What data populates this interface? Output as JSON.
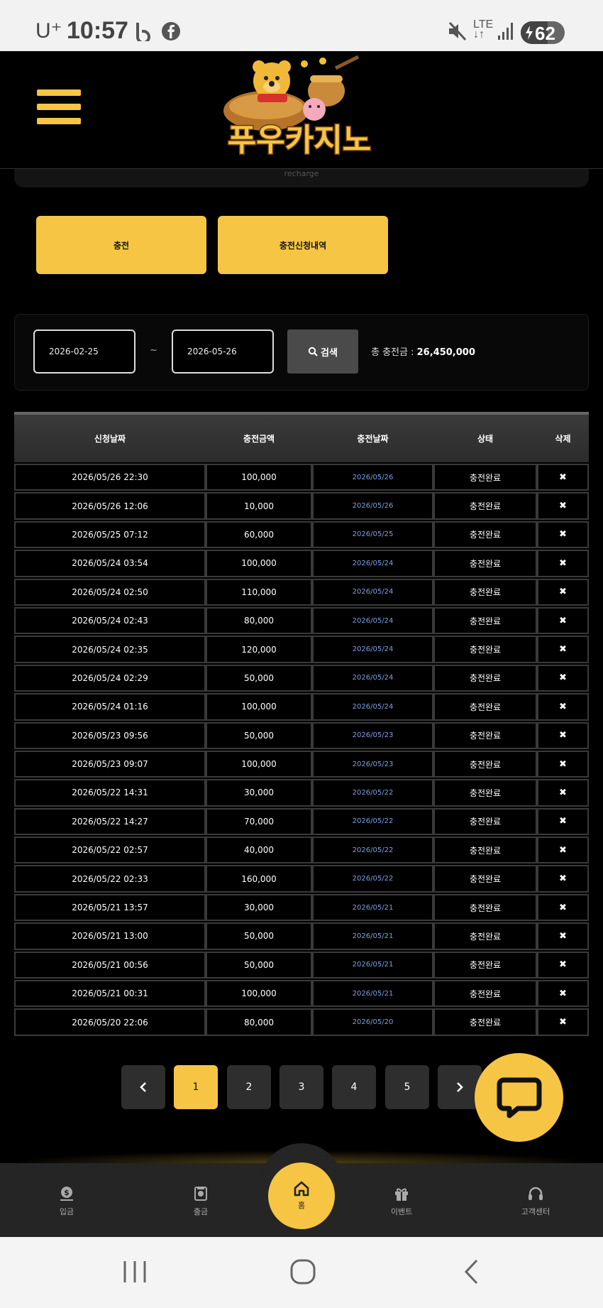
{
  "status_bar": {
    "carrier": "U⁺",
    "time": "10:57",
    "network": "LTE",
    "battery": "62"
  },
  "header": {
    "logo_text": "푸우카지노",
    "recharge_label": "recharge"
  },
  "tabs": [
    {
      "label": "충전"
    },
    {
      "label": "충전신청내역"
    }
  ],
  "search": {
    "start_date": "2026-02-25",
    "separator": "~",
    "end_date": "2026-05-26",
    "button_label": "검색",
    "total_label": "총 충전금 :",
    "total_value": "26,450,000"
  },
  "table": {
    "headers": [
      "신청날짜",
      "충전금액",
      "충전날짜",
      "상태",
      "삭제"
    ],
    "rows": [
      {
        "requested": "2026/05/26 22:30",
        "amount": "100,000",
        "charged": "2026/05/26",
        "status": "충전완료"
      },
      {
        "requested": "2026/05/26 12:06",
        "amount": "10,000",
        "charged": "2026/05/26",
        "status": "충전완료"
      },
      {
        "requested": "2026/05/25 07:12",
        "amount": "60,000",
        "charged": "2026/05/25",
        "status": "충전완료"
      },
      {
        "requested": "2026/05/24 03:54",
        "amount": "100,000",
        "charged": "2026/05/24",
        "status": "충전완료"
      },
      {
        "requested": "2026/05/24 02:50",
        "amount": "110,000",
        "charged": "2026/05/24",
        "status": "충전완료"
      },
      {
        "requested": "2026/05/24 02:43",
        "amount": "80,000",
        "charged": "2026/05/24",
        "status": "충전완료"
      },
      {
        "requested": "2026/05/24 02:35",
        "amount": "120,000",
        "charged": "2026/05/24",
        "status": "충전완료"
      },
      {
        "requested": "2026/05/24 02:29",
        "amount": "50,000",
        "charged": "2026/05/24",
        "status": "충전완료"
      },
      {
        "requested": "2026/05/24 01:16",
        "amount": "100,000",
        "charged": "2026/05/24",
        "status": "충전완료"
      },
      {
        "requested": "2026/05/23 09:56",
        "amount": "50,000",
        "charged": "2026/05/23",
        "status": "충전완료"
      },
      {
        "requested": "2026/05/23 09:07",
        "amount": "100,000",
        "charged": "2026/05/23",
        "status": "충전완료"
      },
      {
        "requested": "2026/05/22 14:31",
        "amount": "30,000",
        "charged": "2026/05/22",
        "status": "충전완료"
      },
      {
        "requested": "2026/05/22 14:27",
        "amount": "70,000",
        "charged": "2026/05/22",
        "status": "충전완료"
      },
      {
        "requested": "2026/05/22 02:57",
        "amount": "40,000",
        "charged": "2026/05/22",
        "status": "충전완료"
      },
      {
        "requested": "2026/05/22 02:33",
        "amount": "160,000",
        "charged": "2026/05/22",
        "status": "충전완료"
      },
      {
        "requested": "2026/05/21 13:57",
        "amount": "30,000",
        "charged": "2026/05/21",
        "status": "충전완료"
      },
      {
        "requested": "2026/05/21 13:00",
        "amount": "50,000",
        "charged": "2026/05/21",
        "status": "충전완료"
      },
      {
        "requested": "2026/05/21 00:56",
        "amount": "50,000",
        "charged": "2026/05/21",
        "status": "충전완료"
      },
      {
        "requested": "2026/05/21 00:31",
        "amount": "100,000",
        "charged": "2026/05/21",
        "status": "충전완료"
      },
      {
        "requested": "2026/05/20 22:06",
        "amount": "80,000",
        "charged": "2026/05/20",
        "status": "충전완료"
      }
    ],
    "delete_symbol": "✖"
  },
  "pagination": {
    "prev_icon": "chevron-left-icon",
    "next_icon": "chevron-right-icon",
    "pages": [
      "1",
      "2",
      "3",
      "4",
      "5"
    ],
    "active": "1"
  },
  "bottom_nav": {
    "items": [
      {
        "label": "입금",
        "icon": "deposit-icon"
      },
      {
        "label": "출금",
        "icon": "withdraw-icon"
      },
      {
        "label": "홈",
        "icon": "home-icon"
      },
      {
        "label": "이벤트",
        "icon": "gift-icon"
      },
      {
        "label": "고객센터",
        "icon": "headset-icon"
      }
    ]
  },
  "colors": {
    "accent": "#f6c544",
    "background": "#000000",
    "date_link": "#7f9fe0"
  }
}
